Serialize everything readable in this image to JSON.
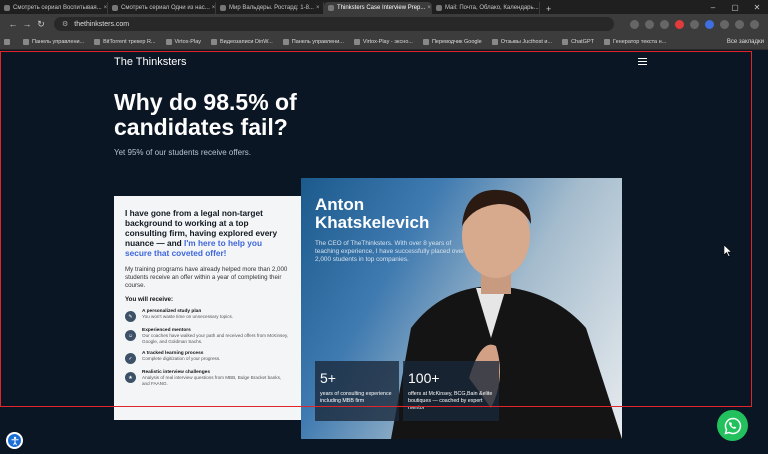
{
  "tabs": [
    {
      "label": "Смотреть сериал Воспитывая...",
      "active": false
    },
    {
      "label": "Смотреть сериал Одни из нас...",
      "active": false
    },
    {
      "label": "Мир Вальдеры. Ростард: 1-8...",
      "active": false
    },
    {
      "label": "Thinksters Case Interview Prep...",
      "active": true
    },
    {
      "label": "Mail: Почта, Облако, Календарь...",
      "active": false
    }
  ],
  "address": {
    "url": "thethinksters.com"
  },
  "bookmarks": [
    "Панель управлени...",
    "BitTorrent трекер R...",
    "Virtox-Play",
    "Видеозаписи DinW...",
    "Панель управлени...",
    "Virtox-Play - эксно...",
    "Переводчик Google",
    "Отзывы Jucthost и...",
    "ChatGPT",
    "Генератор текста н..."
  ],
  "bookmarks_more": "Все закладки",
  "site": {
    "brand": "The Thinksters",
    "headline": "Why do 98.5% of candidates fail?",
    "subheadline": "Yet 95% of our students receive offers.",
    "card": {
      "lead": "I have gone from a legal non-target background to working at a top consulting firm, having explored every nuance — and ",
      "lead_highlight": "I'm here to help you secure that coveted offer!",
      "paragraph": "My training programs have already helped more than 2,000 students receive an offer within a year of completing their course.",
      "receive_heading": "You will receive:",
      "features": [
        {
          "title": "A personalized study plan",
          "desc": "You won't waste time on unnecessary topics."
        },
        {
          "title": "Experienced mentors",
          "desc": "Our coaches have walked your path and received offers from McKinsey, Google, and Goldman Sachs."
        },
        {
          "title": "A tracked learning process",
          "desc": "Complete digitization of your progress."
        },
        {
          "title": "Realistic interview challenges",
          "desc": "Analysis of real interview questions from MBB, Bulge Bracket banks, and FAANG."
        }
      ]
    },
    "hero": {
      "name_first": "Anton",
      "name_last": "Khatskelevich",
      "description": "The CEO of TheThinksters. With over 8 years of teaching experience, I have successfully placed over 2,000 students in top companies.",
      "stats": [
        {
          "num": "5+",
          "label": "years of consulting experience including MBB firm"
        },
        {
          "num": "100+",
          "label": "offers at McKinsey, BCG,Bain &elite boutiques — coached by expert mentor"
        }
      ]
    }
  },
  "colors": {
    "accent": "#3d66db",
    "page_bg": "#0b1624",
    "whatsapp": "#22c15e",
    "highlight_box": "#e0262b"
  }
}
